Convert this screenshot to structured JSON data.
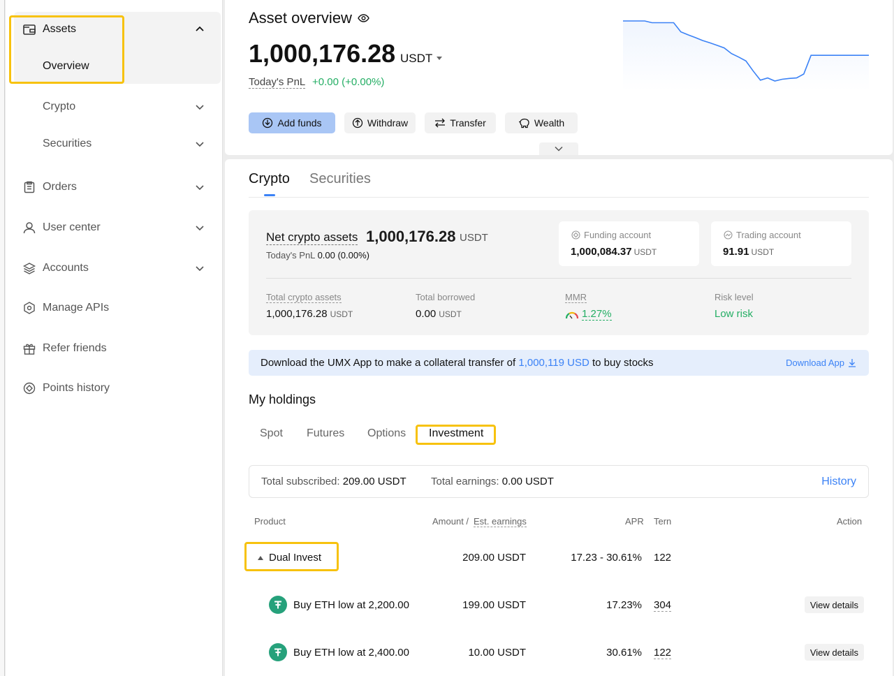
{
  "sidebar": {
    "assets_label": "Assets",
    "overview_label": "Overview",
    "items": [
      {
        "label": "Crypto"
      },
      {
        "label": "Securities"
      },
      {
        "label": "Orders"
      },
      {
        "label": "User center"
      },
      {
        "label": "Accounts"
      },
      {
        "label": "Manage APIs"
      },
      {
        "label": "Refer friends"
      },
      {
        "label": "Points history"
      }
    ]
  },
  "overview": {
    "title": "Asset overview",
    "total_value": "1,000,176.28",
    "currency": "USDT",
    "pnl_label": "Today's PnL",
    "pnl_value": "+0.00 (+0.00%)",
    "buttons": {
      "add_funds": "Add funds",
      "withdraw": "Withdraw",
      "transfer": "Transfer",
      "wealth": "Wealth"
    },
    "accent_color": "#3b82f6",
    "positive_color": "#24ae64"
  },
  "main": {
    "tabs": [
      "Crypto",
      "Securities"
    ],
    "net_label": "Net crypto assets",
    "net_value": "1,000,176.28",
    "net_unit": "USDT",
    "net_pnl_label": "Today's PnL",
    "net_pnl_value": "0.00 (0.00%)",
    "funding": {
      "label": "Funding account",
      "value": "1,000,084.37",
      "unit": "USDT"
    },
    "trading": {
      "label": "Trading account",
      "value": "91.91",
      "unit": "USDT"
    },
    "stats": {
      "total_assets_label": "Total crypto assets",
      "total_assets_value": "1,000,176.28",
      "total_assets_unit": "USDT",
      "borrowed_label": "Total borrowed",
      "borrowed_value": "0.00",
      "borrowed_unit": "USDT",
      "mmr_label": "MMR",
      "mmr_value": "1.27%",
      "risk_label": "Risk level",
      "risk_value": "Low risk"
    },
    "banner": {
      "prefix": "Download the UMX App to make a collateral transfer of",
      "amount": "1,000,119 USD",
      "suffix": "to buy stocks",
      "link": "Download App"
    },
    "holdings_title": "My holdings",
    "holdings_tabs": [
      "Spot",
      "Futures",
      "Options",
      "Investment"
    ],
    "totals": {
      "subscribed_label": "Total subscribed:",
      "subscribed_value": "209.00 USDT",
      "earnings_label": "Total earnings:",
      "earnings_value": "0.00 USDT",
      "history": "History"
    },
    "table": {
      "headers": {
        "product": "Product",
        "amount": "Amount /",
        "est": "Est. earnings",
        "apr": "APR",
        "term": "Tern",
        "action": "Action"
      },
      "group": {
        "name": "Dual Invest",
        "amount": "209.00 USDT",
        "apr": "17.23 - 30.61%",
        "term": "122"
      },
      "rows": [
        {
          "product": "Buy ETH low at 2,200.00",
          "amount": "199.00 USDT",
          "apr": "17.23%",
          "term": "304",
          "action": "View details"
        },
        {
          "product": "Buy ETH low at 2,400.00",
          "amount": "10.00 USDT",
          "apr": "30.61%",
          "term": "122",
          "action": "View details"
        }
      ]
    }
  },
  "sparkline": {
    "type": "line",
    "values": [
      100,
      100,
      100,
      100,
      99.6,
      99.6,
      99.6,
      99.6,
      97.5,
      96.8,
      96.2,
      95.5,
      95.0,
      94.4,
      93.8,
      92.5,
      91.7,
      90.8,
      88.5,
      86.4,
      86.9,
      86.2,
      86.6,
      86.8,
      86.9,
      87.8,
      92.1,
      92.1,
      92.1,
      92.1,
      92.1,
      92.1,
      92.1,
      92.1,
      92.1
    ],
    "color": "#3b82f6"
  }
}
